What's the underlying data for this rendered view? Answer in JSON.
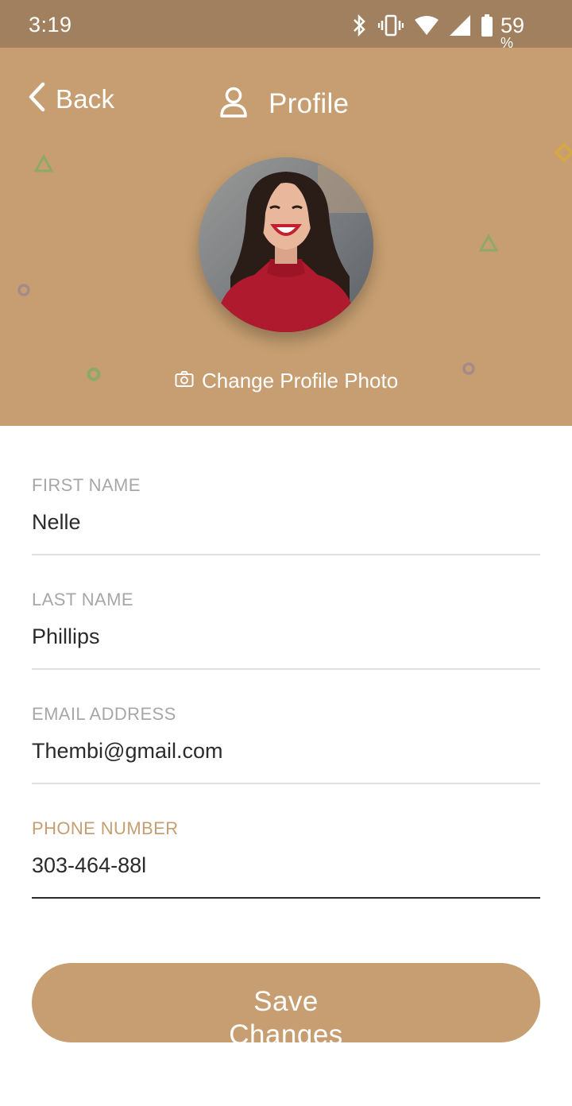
{
  "status_bar": {
    "time": "3:19",
    "battery_level": "59",
    "battery_unit": "%"
  },
  "header": {
    "back_label": "Back",
    "title": "Profile",
    "change_photo_label": "Change Profile Photo",
    "background_color": "#c69e71"
  },
  "icons": {
    "back": "chevron-left-icon",
    "profile": "user-icon",
    "camera": "camera-icon",
    "bluetooth": "bluetooth-icon",
    "vibrate": "vibrate-icon",
    "wifi": "wifi-icon",
    "signal": "signal-icon",
    "battery": "battery-icon"
  },
  "form": {
    "first_name": {
      "label": "FIRST NAME",
      "value": "Nelle"
    },
    "last_name": {
      "label": "LAST NAME",
      "value": "Phillips"
    },
    "email": {
      "label": "EMAIL ADDRESS",
      "value": "Thembi@gmail.com"
    },
    "phone": {
      "label": "PHONE NUMBER",
      "value": "303-464-88l"
    }
  },
  "save_button": {
    "label": "Save Changes"
  },
  "colors": {
    "accent": "#c69e71",
    "status_bar": "#a0805e",
    "label_gray": "#a7a7a7",
    "text": "#2b2b2b"
  }
}
